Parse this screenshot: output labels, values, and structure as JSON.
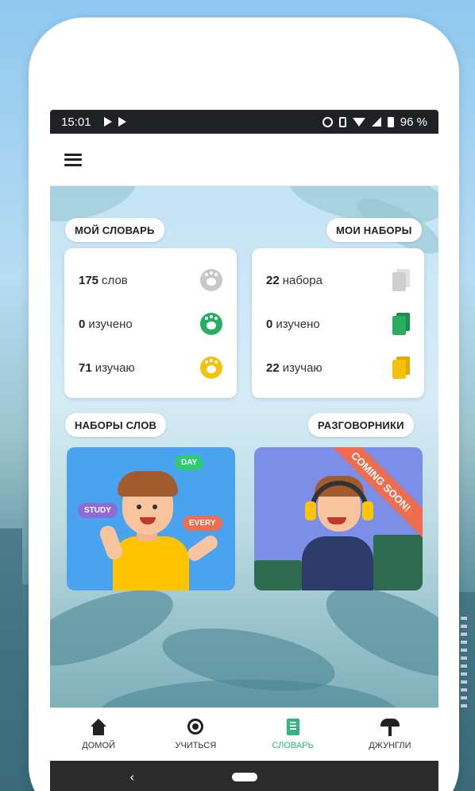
{
  "status_bar": {
    "time": "15:01",
    "battery": "96 %"
  },
  "appbar": {
    "menu_icon": "menu-icon"
  },
  "sections": {
    "my_dictionary": "МОЙ СЛОВАРЬ",
    "my_sets": "МОИ НАБОРЫ",
    "word_sets": "НАБОРЫ СЛОВ",
    "phrasebooks": "РАЗГОВОРНИКИ"
  },
  "dictionary_card": {
    "rows": [
      {
        "count": "175",
        "label": "слов",
        "icon": "paw-icon",
        "color": "#c8c8c8"
      },
      {
        "count": "0",
        "label": "изучено",
        "icon": "paw-icon",
        "color": "#27ae60"
      },
      {
        "count": "71",
        "label": "изучаю",
        "icon": "paw-icon",
        "color": "#f4c20d"
      }
    ]
  },
  "sets_card": {
    "rows": [
      {
        "count": "22",
        "label": "набора",
        "icon": "cards-icon",
        "color": "#cfcfcf"
      },
      {
        "count": "0",
        "label": "изучено",
        "icon": "cards-icon",
        "color": "#27ae60"
      },
      {
        "count": "22",
        "label": "изучаю",
        "icon": "cards-icon",
        "color": "#f4c20d"
      }
    ]
  },
  "word_sets_tile": {
    "bubbles": [
      "DAY",
      "STUDY",
      "EVERY"
    ]
  },
  "phrasebook_tile": {
    "ribbon": "COMING SOON!"
  },
  "bottom_nav": {
    "items": [
      {
        "label": "ДОМОЙ",
        "icon": "home-icon",
        "active": false
      },
      {
        "label": "УЧИТЬСЯ",
        "icon": "target-icon",
        "active": false
      },
      {
        "label": "СЛОВАРЬ",
        "icon": "book-icon",
        "active": true
      },
      {
        "label": "ДЖУНГЛИ",
        "icon": "palm-icon",
        "active": false
      }
    ]
  },
  "colors": {
    "accent": "#2eb67d",
    "learned": "#27ae60",
    "learning": "#f4c20d"
  }
}
